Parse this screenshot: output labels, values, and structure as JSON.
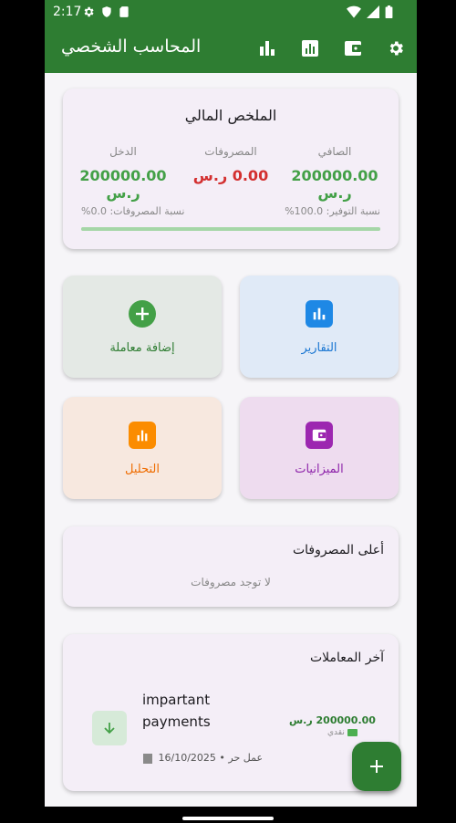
{
  "status_bar": {
    "time": "2:17"
  },
  "app_bar": {
    "title": "المحاسب الشخصي"
  },
  "summary": {
    "title": "الملخص المالي",
    "net_label": "الصافي",
    "net_value": "200000.00 ر.س",
    "expenses_label": "المصروفات",
    "expenses_value": "0.00 ر.س",
    "income_label": "الدخل",
    "income_value": "200000.00 ر.س",
    "savings_ratio": "نسبة التوفير: 100.0%",
    "expense_ratio": "نسبة المصروفات: 0.0%",
    "savings_progress": 1.0
  },
  "tiles": {
    "reports": "التقارير",
    "add_transaction": "إضافة معاملة",
    "budgets": "الميزانيات",
    "analysis": "التحليل"
  },
  "top_expenses": {
    "title": "أعلى المصروفات",
    "empty": "لا توجد مصروفات"
  },
  "recent": {
    "title": "آخر المعاملات",
    "items": [
      {
        "title": "impartant payments",
        "amount": "200000.00 ر.س",
        "method": "نقدي",
        "category": "عمل حر",
        "date": "16/10/2025"
      }
    ]
  },
  "colors": {
    "primary": "#2e7d32",
    "expense": "#d32f2f",
    "reports": "#1e88e5",
    "analysis": "#fb8c00",
    "budgets": "#9c27b0"
  }
}
